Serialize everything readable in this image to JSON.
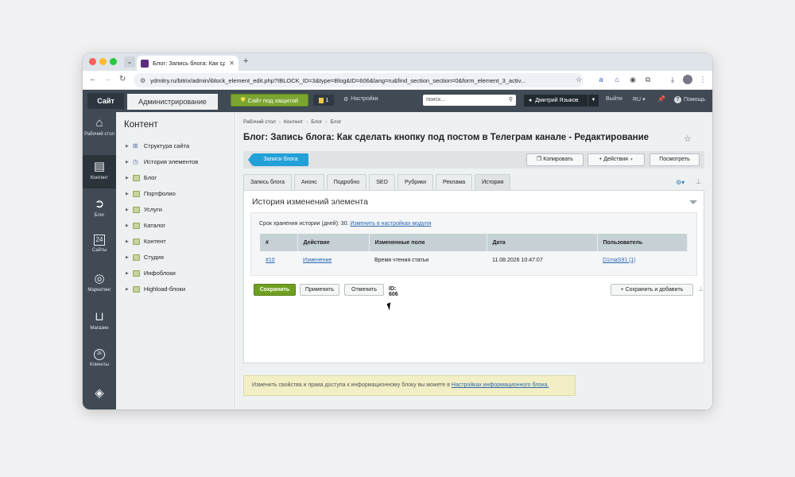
{
  "browser": {
    "tab_title": "Блог: Запись блога: Как сдела",
    "url": "ydmitry.ru/bitrix/admin/iblock_element_edit.php?IBLOCK_ID=3&type=Blog&ID=606&lang=ru&find_section_section=0&form_element_3_activ..."
  },
  "adminbar": {
    "site": "Сайт",
    "admin": "Администрирование",
    "protected": "Сайт под защитой",
    "notif_count": "1",
    "settings": "Настройки",
    "search_placeholder": "поиск...",
    "user": "Дмитрий Языков",
    "exit": "Выйти",
    "lang": "RU",
    "help": "Помощь"
  },
  "sidebar": {
    "items": [
      {
        "label": "Рабочий стол",
        "icon": "home-icon"
      },
      {
        "label": "Контент",
        "icon": "document-icon"
      },
      {
        "label": "Блог",
        "icon": "arrow-circle-icon"
      },
      {
        "label": "Сайты",
        "icon": "calendar-icon"
      },
      {
        "label": "Маркетинг",
        "icon": "target-icon"
      },
      {
        "label": "Магазин",
        "icon": "basket-icon"
      },
      {
        "label": "Клиенты",
        "icon": "clients-icon"
      },
      {
        "label": "",
        "icon": "layers-icon"
      }
    ],
    "calendar_day": "24",
    "clients_badge": "2k"
  },
  "tree": {
    "title": "Контент",
    "items": [
      "Структура сайта",
      "История элементов",
      "Блог",
      "Портфолио",
      "Услуги",
      "Каталог",
      "Контент",
      "Студия",
      "Инфоблоки",
      "Highload-блоки"
    ]
  },
  "breadcrumbs": [
    "Рабочий стол",
    "Контент",
    "Блог",
    "Блог"
  ],
  "page_title": "Блог: Запись блога: Как сделать кнопку под постом в Телеграм канале - Редактирование",
  "toolbar": {
    "records": "Записи блога",
    "copy": "Копировать",
    "actions": "Действия",
    "view": "Посмотреть"
  },
  "tabs": [
    "Запись блога",
    "Анонс",
    "Подробно",
    "SEO",
    "Рубрики",
    "Реклама",
    "История"
  ],
  "history": {
    "title": "История изменений элемента",
    "keep_label": "Срок хранения истории (дней): 30.",
    "keep_link": "Изменить в настройках модуля",
    "columns": [
      "#",
      "Действие",
      "Измененные поля",
      "Дата",
      "Пользователь"
    ],
    "rows": [
      {
        "num": "#10",
        "action": "Изменение",
        "fields": "Время чтения статьи",
        "date": "11.08.2026 10:47:07",
        "user": "D1maS91 (1)"
      }
    ]
  },
  "buttons": {
    "save": "Сохранить",
    "apply": "Применить",
    "cancel": "Отменить",
    "id": "ID: 606",
    "save_add": "Сохранить и добавить"
  },
  "note": {
    "text": "Изменить свойства и права доступа к информационному блоку вы можете в",
    "link": "Настройках информационного блока."
  }
}
